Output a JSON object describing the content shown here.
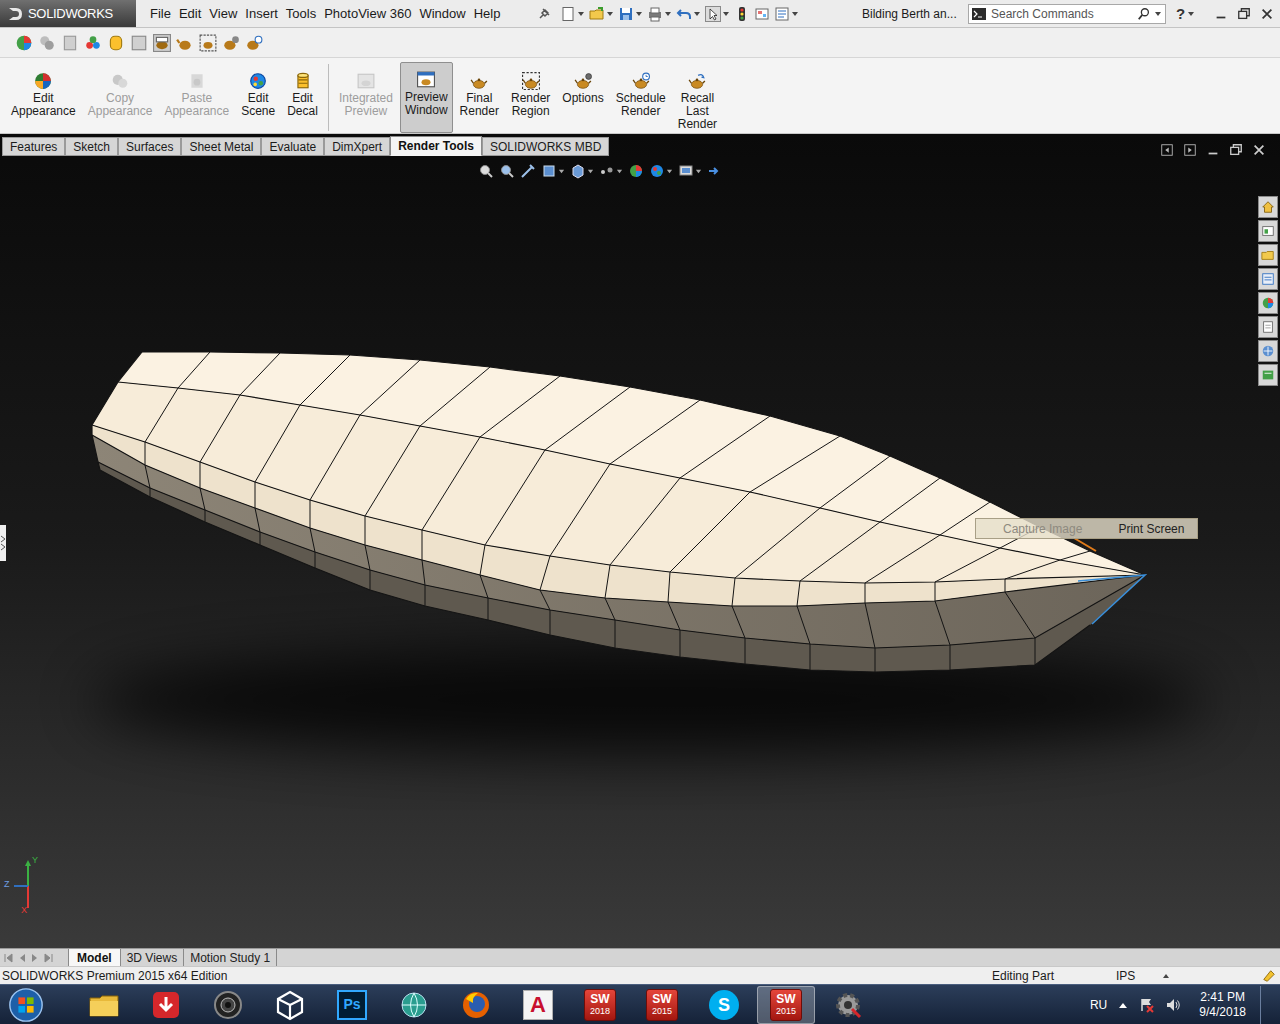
{
  "app": {
    "logo": "SOLIDWORKS"
  },
  "menu": [
    "File",
    "Edit",
    "View",
    "Insert",
    "Tools",
    "PhotoView 360",
    "Window",
    "Help"
  ],
  "document_title": "Bilding Berth an...",
  "search": {
    "placeholder": "Search Commands"
  },
  "help_label": "?",
  "ribbon": [
    {
      "label": [
        "Edit",
        "Appearance"
      ],
      "disabled": false,
      "selected": false
    },
    {
      "label": [
        "Copy",
        "Appearance"
      ],
      "disabled": true,
      "selected": false
    },
    {
      "label": [
        "Paste",
        "Appearance"
      ],
      "disabled": true,
      "selected": false
    },
    {
      "label": [
        "Edit",
        "Scene"
      ],
      "disabled": false,
      "selected": false
    },
    {
      "label": [
        "Edit",
        "Decal"
      ],
      "disabled": false,
      "selected": false
    },
    {
      "label": [
        "Integrated",
        "Preview"
      ],
      "disabled": true,
      "selected": false
    },
    {
      "label": [
        "Preview",
        "Window"
      ],
      "disabled": false,
      "selected": true
    },
    {
      "label": [
        "Final",
        "Render"
      ],
      "disabled": false,
      "selected": false
    },
    {
      "label": [
        "Render",
        "Region"
      ],
      "disabled": false,
      "selected": false
    },
    {
      "label": [
        "Options"
      ],
      "disabled": false,
      "selected": false
    },
    {
      "label": [
        "Schedule",
        "Render"
      ],
      "disabled": false,
      "selected": false
    },
    {
      "label": [
        "Recall",
        "Last",
        "Render"
      ],
      "disabled": false,
      "selected": false
    }
  ],
  "tabs": [
    {
      "label": "Features",
      "selected": false
    },
    {
      "label": "Sketch",
      "selected": false
    },
    {
      "label": "Surfaces",
      "selected": false
    },
    {
      "label": "Sheet Metal",
      "selected": false
    },
    {
      "label": "Evaluate",
      "selected": false
    },
    {
      "label": "DimXpert",
      "selected": false
    },
    {
      "label": "Render Tools",
      "selected": true
    },
    {
      "label": "SOLIDWORKS MBD",
      "selected": false
    }
  ],
  "context_menu": [
    {
      "label": "Capture Image",
      "disabled": true
    },
    {
      "label": "Print Screen",
      "disabled": false
    }
  ],
  "triad": {
    "x": "X",
    "y": "Y",
    "z": "Z"
  },
  "model_tabs": [
    {
      "label": "Model",
      "selected": true
    },
    {
      "label": "3D Views",
      "selected": false
    },
    {
      "label": "Motion Study 1",
      "selected": false
    }
  ],
  "status_bar": {
    "edition": "SOLIDWORKS Premium 2015 x64 Edition",
    "mode": "Editing Part",
    "units": "IPS"
  },
  "taskbar": {
    "apps": [
      {
        "kind": "folder",
        "active": false
      },
      {
        "kind": "download",
        "active": false
      },
      {
        "kind": "camera",
        "active": false
      },
      {
        "kind": "unity",
        "active": false
      },
      {
        "kind": "photoshop",
        "text": "Ps",
        "active": false
      },
      {
        "kind": "globe",
        "active": false
      },
      {
        "kind": "firefox",
        "active": false
      },
      {
        "kind": "autocad",
        "text": "A",
        "active": false
      },
      {
        "kind": "solidworks",
        "text": "SW",
        "sub": "2018",
        "active": false
      },
      {
        "kind": "solidworks",
        "text": "SW",
        "sub": "2015",
        "active": false
      },
      {
        "kind": "skype",
        "text": "S",
        "active": false
      },
      {
        "kind": "solidworks",
        "text": "SW",
        "sub": "2015",
        "active": true
      },
      {
        "kind": "gear",
        "active": false
      }
    ],
    "language": "RU",
    "time": "2:41 PM",
    "date": "9/4/2018"
  }
}
